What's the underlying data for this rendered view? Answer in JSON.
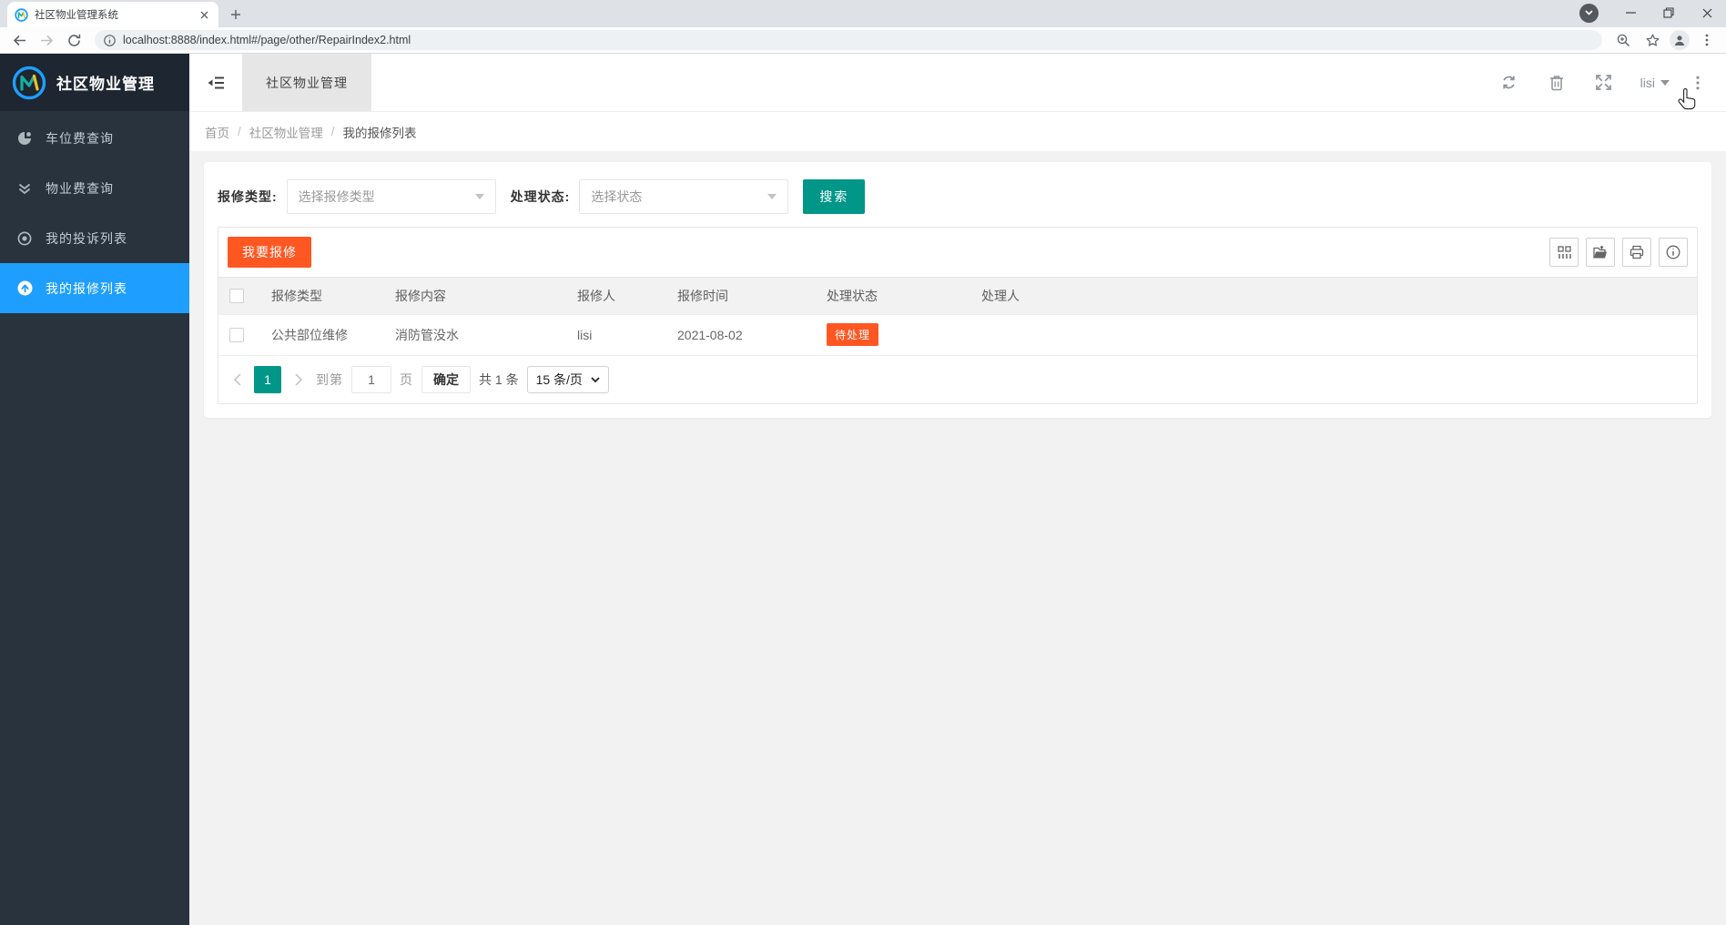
{
  "browser": {
    "tab_title": "社区物业管理系统",
    "url": "localhost:8888/index.html#/page/other/RepairIndex2.html"
  },
  "sidebar": {
    "logo_text": "社区物业管理",
    "items": [
      {
        "label": "车位费查询",
        "icon": "dashboard-icon"
      },
      {
        "label": "物业费查询",
        "icon": "double-chevron-down-icon"
      },
      {
        "label": "我的投诉列表",
        "icon": "circle-dot-icon"
      },
      {
        "label": "我的报修列表",
        "icon": "circle-arrow-up-icon"
      }
    ]
  },
  "header": {
    "tab_label": "社区物业管理",
    "username": "lisi"
  },
  "breadcrumb": {
    "separator": "/",
    "items": [
      "首页",
      "社区物业管理",
      "我的报修列表"
    ]
  },
  "filters": {
    "repair_type_label": "报修类型:",
    "repair_type_placeholder": "选择报修类型",
    "status_label": "处理状态:",
    "status_placeholder": "选择状态",
    "search_label": "搜索"
  },
  "table": {
    "add_button_label": "我要报修",
    "columns": [
      "报修类型",
      "报修内容",
      "报修人",
      "报修时间",
      "处理状态",
      "处理人"
    ],
    "rows": [
      {
        "type": "公共部位维修",
        "content": "消防管没水",
        "reporter": "lisi",
        "time": "2021-08-02",
        "status": "待处理",
        "handler": ""
      }
    ]
  },
  "pagination": {
    "current_page": "1",
    "goto_label": "到第",
    "page_input": "1",
    "page_unit_label": "页",
    "confirm_label": "确定",
    "total_label": "共 1 条",
    "page_size_label": "15 条/页"
  },
  "colors": {
    "sidebar_bg": "#28333e",
    "sidebar_logo_bg": "#1d2631",
    "active_menu_blue": "#1e9fff",
    "primary_green": "#009688",
    "accent_orange": "#ff5722",
    "content_bg": "#f2f2f2"
  }
}
